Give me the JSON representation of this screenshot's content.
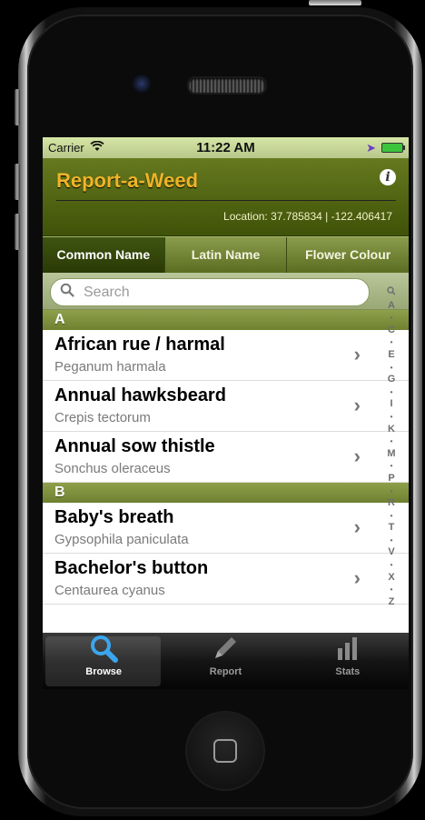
{
  "status_bar": {
    "carrier": "Carrier",
    "time": "11:22 AM"
  },
  "header": {
    "title": "Report-a-Weed",
    "location": "Location: 37.785834 | -122.406417"
  },
  "segments": [
    "Common Name",
    "Latin Name",
    "Flower Colour"
  ],
  "search": {
    "placeholder": "Search"
  },
  "sections": [
    {
      "letter": "A",
      "items": [
        {
          "name": "African rue / harmal",
          "latin": "Peganum harmala"
        },
        {
          "name": "Annual hawksbeard",
          "latin": "Crepis tectorum"
        },
        {
          "name": "Annual sow thistle",
          "latin": "Sonchus oleraceus"
        }
      ]
    },
    {
      "letter": "B",
      "items": [
        {
          "name": "Baby's breath",
          "latin": "Gypsophila paniculata"
        },
        {
          "name": "Bachelor's button",
          "latin": "Centaurea cyanus"
        }
      ]
    }
  ],
  "index": [
    "A",
    "•",
    "C",
    "•",
    "E",
    "•",
    "G",
    "•",
    "I",
    "•",
    "K",
    "•",
    "M",
    "•",
    "P",
    "•",
    "R",
    "•",
    "T",
    "•",
    "V",
    "•",
    "X",
    "•",
    "Z"
  ],
  "tabs": [
    {
      "label": "Browse",
      "active": true
    },
    {
      "label": "Report",
      "active": false
    },
    {
      "label": "Stats",
      "active": false
    }
  ],
  "colors": {
    "accent": "#f0b428",
    "header_green": "#4f6212",
    "tab_active": "#3aa6ef"
  }
}
